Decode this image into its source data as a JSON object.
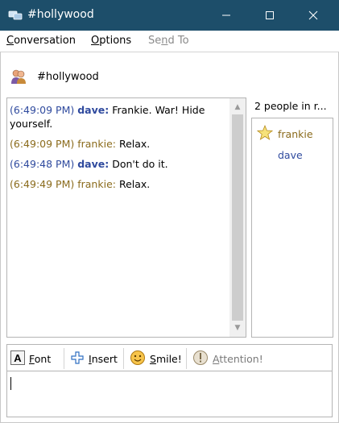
{
  "window": {
    "title": "#hollywood",
    "minimize_glyph": "—",
    "maximize_glyph": "☐",
    "close_glyph": "✕"
  },
  "menu": {
    "conversation": "Conversation",
    "options": "Options",
    "send_to": "Send To"
  },
  "room": {
    "name": "#hollywood"
  },
  "chat": {
    "messages": [
      {
        "time": "(6:49:09 PM)",
        "nick": "dave:",
        "text": " Frankie. War! Hide yourself."
      },
      {
        "time": "(6:49:09 PM)",
        "nick": "frankie:",
        "text": " Relax."
      },
      {
        "time": "(6:49:48 PM)",
        "nick": "dave:",
        "text": " Don't do it."
      },
      {
        "time": "(6:49:49 PM)",
        "nick": "frankie:",
        "text": " Relax."
      }
    ]
  },
  "people": {
    "header": "2 people in r...",
    "users": [
      {
        "name": "frankie"
      },
      {
        "name": "dave"
      }
    ]
  },
  "toolbar": {
    "font": "Font",
    "insert": "Insert",
    "smile": "Smile!",
    "attention": "Attention!"
  },
  "colors": {
    "titlebar": "#1d4e6a",
    "nick_blue": "#2f4a9e",
    "nick_gold": "#8b6b1c"
  }
}
